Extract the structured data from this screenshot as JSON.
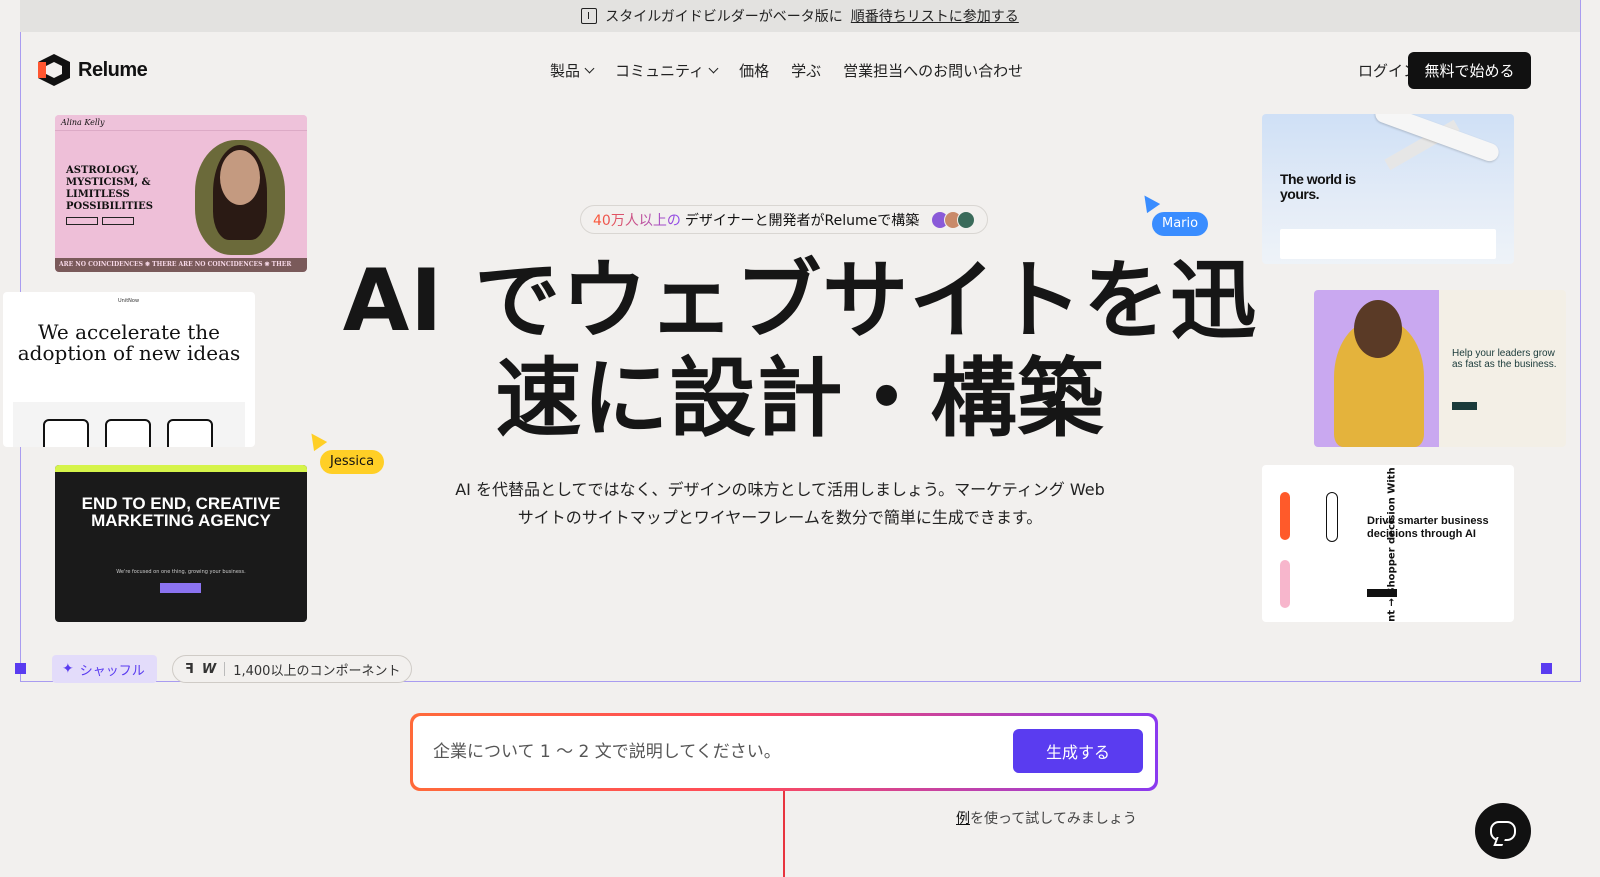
{
  "banner": {
    "text": "スタイルガイドビルダーがベータ版に",
    "link": "順番待ちリストに参加する"
  },
  "nav": {
    "brand": "Relume",
    "items": [
      {
        "label": "製品",
        "dropdown": true
      },
      {
        "label": "コミュニティ",
        "dropdown": true
      },
      {
        "label": "価格",
        "dropdown": false
      },
      {
        "label": "学ぶ",
        "dropdown": false
      },
      {
        "label": "営業担当へのお問い合わせ",
        "dropdown": false
      }
    ],
    "login": "ログイン",
    "cta": "無料で始める"
  },
  "hero": {
    "social_highlight": "40万人以上の",
    "social_rest": "デザイナーと開発者がRelumeで構築",
    "title_line1": "AI でウェブサイトを迅",
    "title_line2": "速に設計・構築",
    "subtitle": "AI を代替品としてではなく、デザインの味方として活用しましょう。マーケティング Web サイトのサイトマップとワイヤーフレームを数分で簡単に生成できます。"
  },
  "cursors": {
    "mario": "Mario",
    "jessica": "Jessica"
  },
  "cards": {
    "astrology": {
      "brand": "Alina Kelly",
      "headline": "ASTROLOGY, MYSTICISM, & LIMITLESS POSSIBILITIES",
      "marquee": "ARE NO COINCIDENCES ❋ THERE ARE NO COINCIDENCES ❋ THER"
    },
    "ideas": {
      "header": "UnitNow",
      "headline": "We accelerate the adoption of new ideas"
    },
    "agency": {
      "headline": "END TO END, CREATIVE MARKETING AGENCY",
      "sub": "We're focused on one thing, growing your business."
    },
    "travel": {
      "headline": "The world is yours."
    },
    "leaders": {
      "headline": "Help your leaders grow as fast as the business."
    },
    "business": {
      "headline": "Drive smarter business decisions through AI",
      "vertical": "Intelligent → Shopper decision With AI"
    }
  },
  "tools": {
    "shuffle": "シャッフル",
    "components": "1,400以上のコンポーネント"
  },
  "prompt": {
    "placeholder": "企業について 1 〜 2 文で説明してください。",
    "button": "生成する"
  },
  "example": {
    "link": "例",
    "rest": "を使って試してみましょう"
  },
  "colors": {
    "accent_purple": "#5a3cf0",
    "accent_orange": "#ff5630",
    "mario_blue": "#3a8dff",
    "jessica_yellow": "#ffcf26"
  },
  "icons": {
    "banner": "style-guide-icon",
    "chat": "chat-support-icon",
    "shuffle": "sparkle-icon",
    "figma": "figma-icon",
    "webflow": "webflow-icon"
  }
}
